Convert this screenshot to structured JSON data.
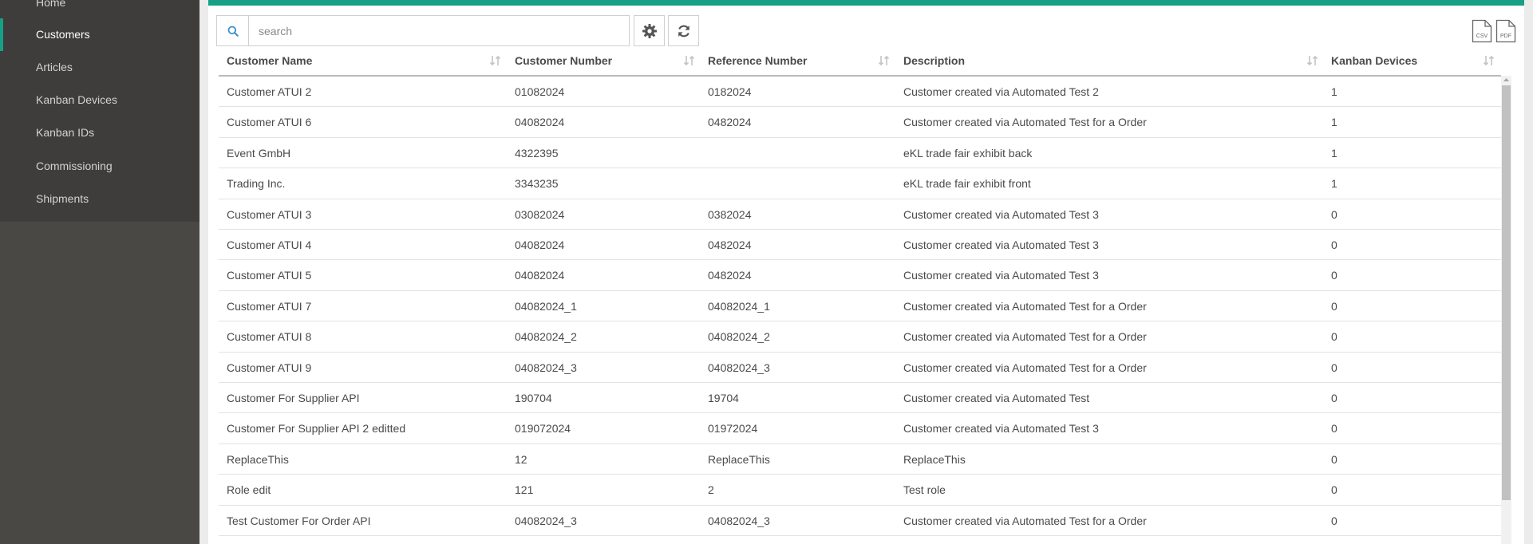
{
  "sidebar": {
    "items": [
      {
        "label": "Home",
        "active": false
      },
      {
        "label": "Customers",
        "active": true
      },
      {
        "label": "Articles",
        "active": false
      },
      {
        "label": "Kanban Devices",
        "active": false
      },
      {
        "label": "Kanban IDs",
        "active": false
      },
      {
        "label": "Commissioning",
        "active": false
      },
      {
        "label": "Shipments",
        "active": false
      }
    ]
  },
  "toolbar": {
    "search_placeholder": "search",
    "search_value": "",
    "settings_icon": "gear-icon",
    "refresh_icon": "refresh-icon",
    "export_csv_label": "CSV",
    "export_pdf_label": "PDF"
  },
  "table": {
    "columns": [
      "Customer Name",
      "Customer Number",
      "Reference Number",
      "Description",
      "Kanban Devices"
    ],
    "rows": [
      [
        "Customer ATUI 2",
        "01082024",
        "0182024",
        "Customer created via Automated Test 2",
        "1"
      ],
      [
        "Customer ATUI 6",
        "04082024",
        "0482024",
        "Customer created via Automated Test for a Order",
        "1"
      ],
      [
        "Event GmbH",
        "4322395",
        "",
        "eKL trade fair exhibit back",
        "1"
      ],
      [
        "Trading Inc.",
        "3343235",
        "",
        "eKL trade fair exhibit front",
        "1"
      ],
      [
        "Customer ATUI 3",
        "03082024",
        "0382024",
        "Customer created via Automated Test 3",
        "0"
      ],
      [
        "Customer ATUI 4",
        "04082024",
        "0482024",
        "Customer created via Automated Test 3",
        "0"
      ],
      [
        "Customer ATUI 5",
        "04082024",
        "0482024",
        "Customer created via Automated Test 3",
        "0"
      ],
      [
        "Customer ATUI 7",
        "04082024_1",
        "04082024_1",
        "Customer created via Automated Test for a Order",
        "0"
      ],
      [
        "Customer ATUI 8",
        "04082024_2",
        "04082024_2",
        "Customer created via Automated Test for a Order",
        "0"
      ],
      [
        "Customer ATUI 9",
        "04082024_3",
        "04082024_3",
        "Customer created via Automated Test for a Order",
        "0"
      ],
      [
        "Customer For Supplier API",
        "190704",
        "19704",
        "Customer created via Automated Test",
        "0"
      ],
      [
        "Customer For Supplier API 2 editted",
        "019072024",
        "01972024",
        "Customer created via Automated Test 3",
        "0"
      ],
      [
        "ReplaceThis",
        "12",
        "ReplaceThis",
        "ReplaceThis",
        "0"
      ],
      [
        "Role edit",
        "121",
        "2",
        "Test role",
        "0"
      ],
      [
        "Test Customer For Order API",
        "04082024_3",
        "04082024_3",
        "Customer created via Automated Test for a Order",
        "0"
      ]
    ]
  },
  "colors": {
    "accent": "#17a085",
    "sidebar_bg": "#3f3d3b",
    "sidebar_dark": "#4a4845"
  }
}
